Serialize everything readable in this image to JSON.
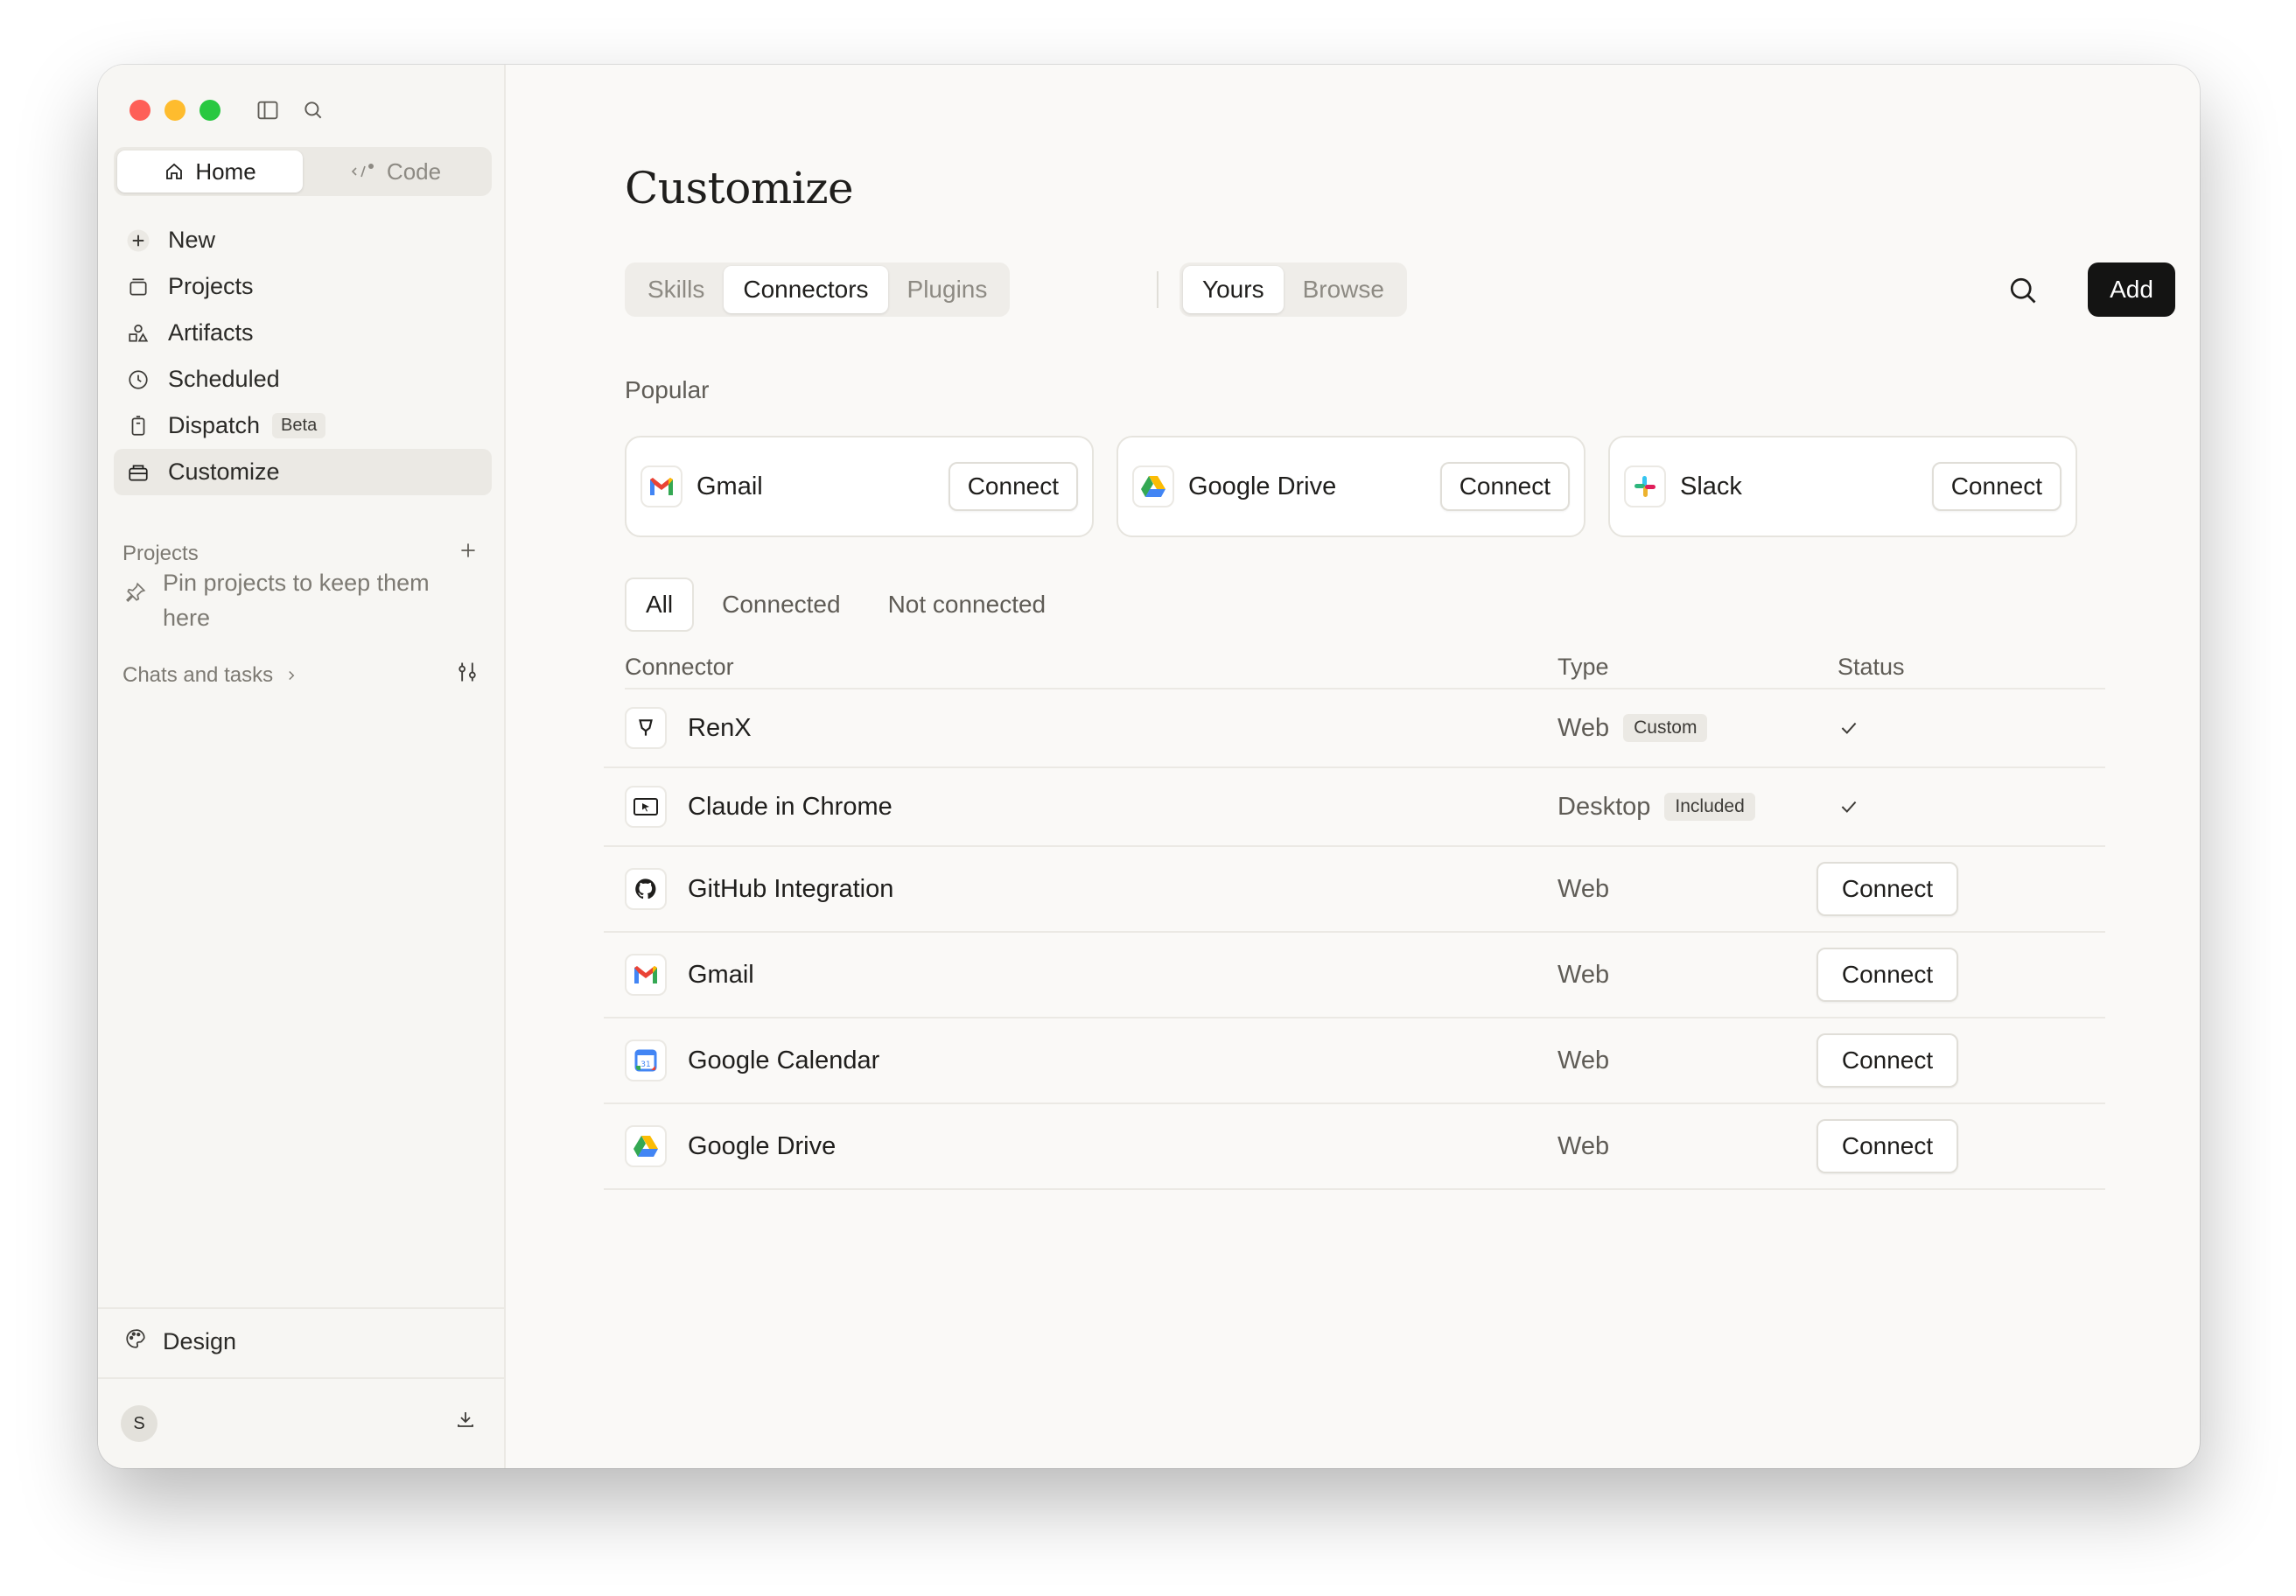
{
  "sidebar": {
    "mode_tabs": [
      {
        "label": "Home",
        "active": true
      },
      {
        "label": "Code",
        "active": false
      }
    ],
    "nav": [
      {
        "label": "New",
        "icon": "plus-icon"
      },
      {
        "label": "Projects",
        "icon": "projects-icon"
      },
      {
        "label": "Artifacts",
        "icon": "artifacts-icon"
      },
      {
        "label": "Scheduled",
        "icon": "clock-icon"
      },
      {
        "label": "Dispatch",
        "icon": "dispatch-icon",
        "badge": "Beta"
      },
      {
        "label": "Customize",
        "icon": "customize-icon",
        "active": true
      }
    ],
    "projects_header": "Projects",
    "projects_empty": "Pin projects to keep them here",
    "chats_header": "Chats and tasks",
    "design_label": "Design",
    "avatar_initial": "S"
  },
  "main": {
    "title": "Customize",
    "section_tabs": [
      {
        "label": "Skills",
        "active": false
      },
      {
        "label": "Connectors",
        "active": true
      },
      {
        "label": "Plugins",
        "active": false
      }
    ],
    "scope_tabs": [
      {
        "label": "Yours",
        "active": true
      },
      {
        "label": "Browse",
        "active": false
      }
    ],
    "add_label": "Add",
    "popular_label": "Popular",
    "popular": [
      {
        "name": "Gmail",
        "button": "Connect",
        "icon": "gmail-icon"
      },
      {
        "name": "Google Drive",
        "button": "Connect",
        "icon": "google-drive-icon"
      },
      {
        "name": "Slack",
        "button": "Connect",
        "icon": "slack-icon"
      }
    ],
    "filter_tabs": [
      {
        "label": "All",
        "active": true
      },
      {
        "label": "Connected",
        "active": false
      },
      {
        "label": "Not connected",
        "active": false
      }
    ],
    "table": {
      "headers": {
        "connector": "Connector",
        "type": "Type",
        "status": "Status"
      },
      "rows": [
        {
          "name": "RenX",
          "type": "Web",
          "badge": "Custom",
          "status": "connected",
          "icon": "renx-icon"
        },
        {
          "name": "Claude in Chrome",
          "type": "Desktop",
          "badge": "Included",
          "status": "connected",
          "icon": "chrome-extension-icon"
        },
        {
          "name": "GitHub Integration",
          "type": "Web",
          "badge": "",
          "status": "Connect",
          "icon": "github-icon"
        },
        {
          "name": "Gmail",
          "type": "Web",
          "badge": "",
          "status": "Connect",
          "icon": "gmail-icon"
        },
        {
          "name": "Google Calendar",
          "type": "Web",
          "badge": "",
          "status": "Connect",
          "icon": "google-calendar-icon"
        },
        {
          "name": "Google Drive",
          "type": "Web",
          "badge": "",
          "status": "Connect",
          "icon": "google-drive-icon"
        }
      ]
    }
  },
  "colors": {
    "accent_dark": "#141413",
    "sidebar_bg": "#f7f6f3",
    "window_bg": "#faf9f7"
  }
}
